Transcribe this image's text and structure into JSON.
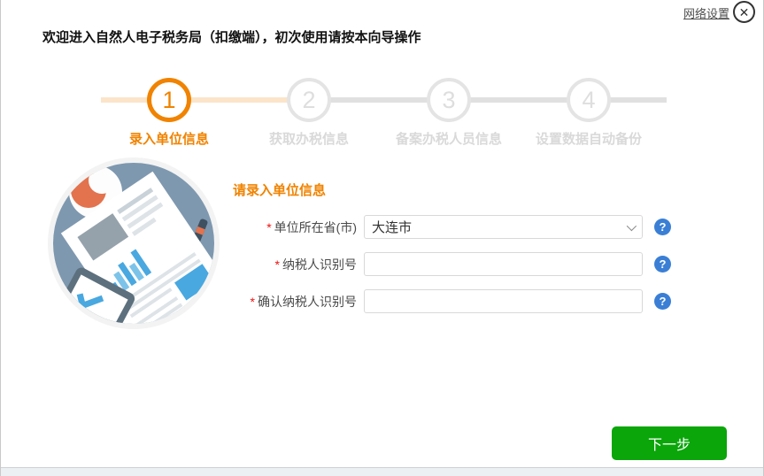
{
  "window_chrome": {
    "network_settings_label": "网络设置",
    "close_glyph": "✕"
  },
  "header": {
    "title": "欢迎进入自然人电子税务局（扣缴端），初次使用请按本向导操作"
  },
  "stepper": {
    "steps": [
      {
        "number": "1",
        "label": "录入单位信息",
        "state": "active"
      },
      {
        "number": "2",
        "label": "获取办税信息",
        "state": "pending"
      },
      {
        "number": "3",
        "label": "备案办税人员信息",
        "state": "pending"
      },
      {
        "number": "4",
        "label": "设置数据自动备份",
        "state": "pending"
      }
    ]
  },
  "form": {
    "heading": "请录入单位信息",
    "required_mark": "*",
    "fields": [
      {
        "label": "单位所在省(市)",
        "type": "select",
        "value": "大连市"
      },
      {
        "label": "纳税人识别号",
        "type": "text",
        "value": ""
      },
      {
        "label": "确认纳税人识别号",
        "type": "text",
        "value": ""
      }
    ],
    "help_glyph": "?",
    "next_button_label": "下一步"
  },
  "colors": {
    "accent_orange": "#f08300",
    "step_done_line": "#fbe4c9",
    "step_pending": "#e4e4e4",
    "help_blue": "#3a7fd5",
    "button_green": "#0aa60a",
    "illustration_bg": "#7e98af",
    "illustration_blue": "#49a8e0",
    "illustration_orange": "#e2734e"
  }
}
